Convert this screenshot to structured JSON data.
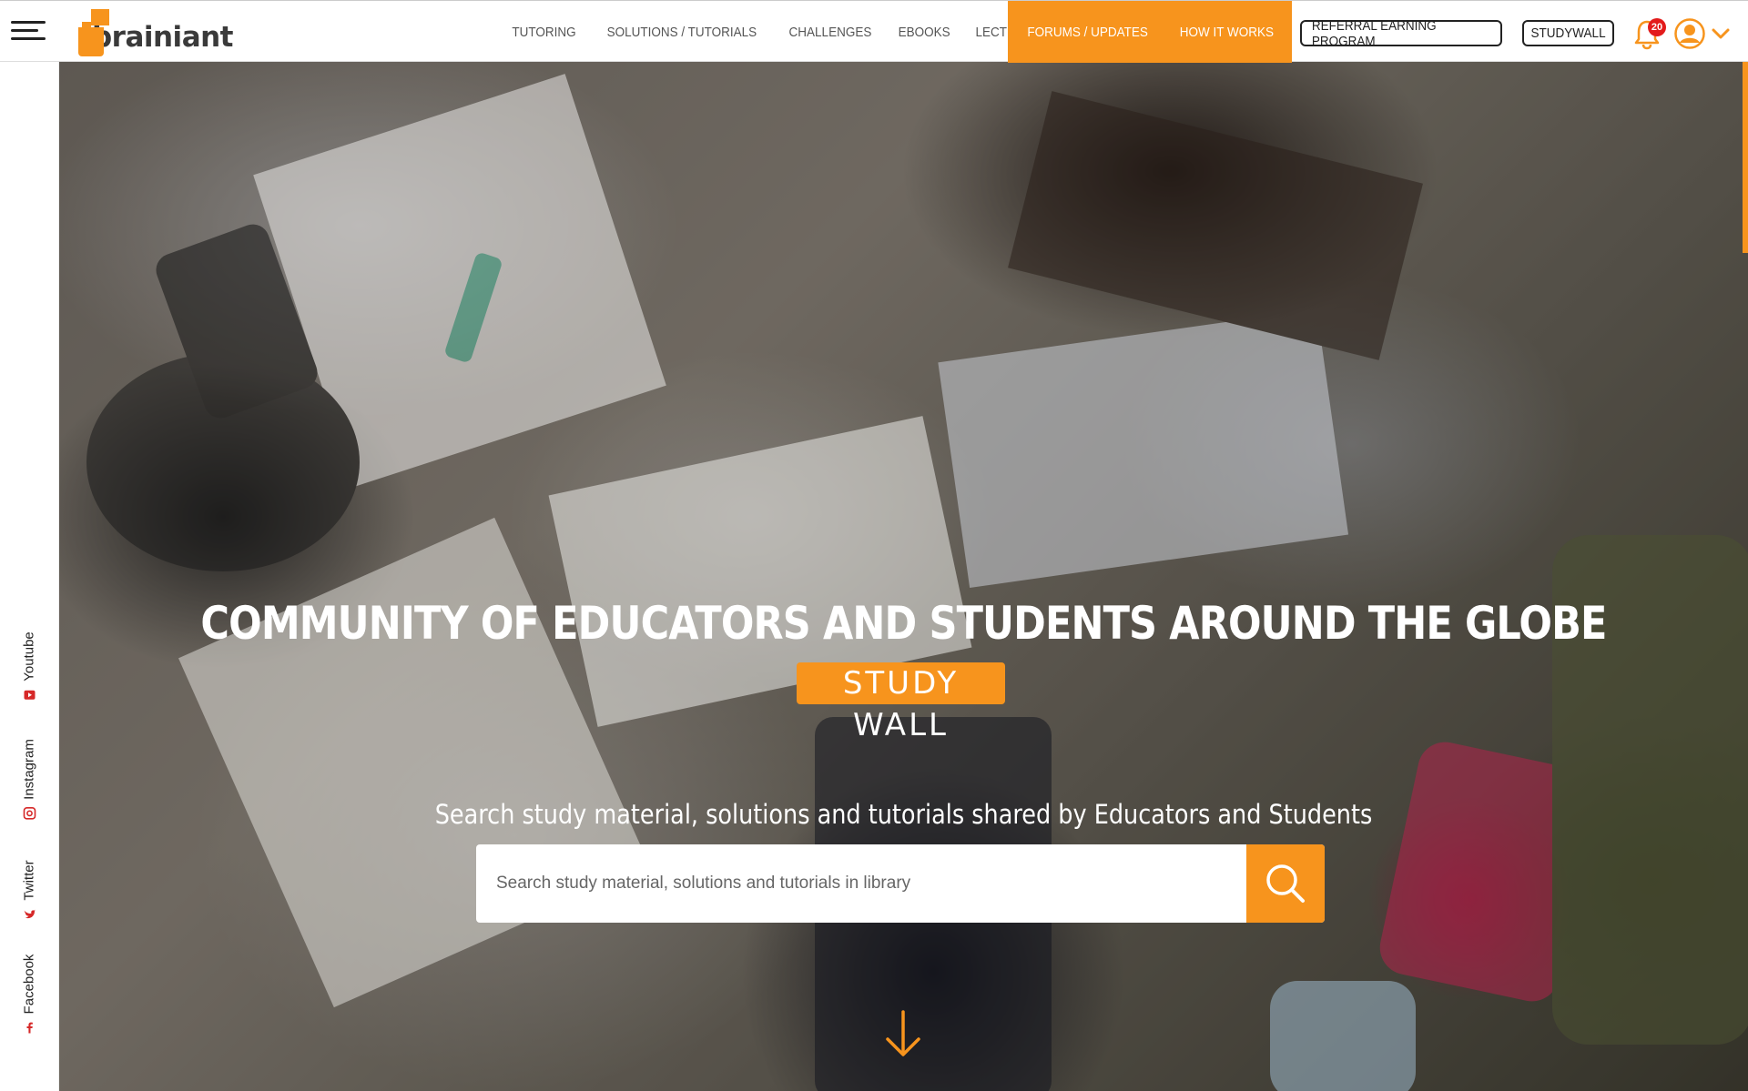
{
  "header": {
    "logo_text": "brainiant",
    "nav": [
      "TUTORING",
      "SOLUTIONS / TUTORIALS",
      "CHALLENGES",
      "EBOOKS",
      "LECTURES"
    ],
    "nav_highlight": [
      "FORUMS / UPDATES",
      "HOW IT WORKS"
    ],
    "referral_label": "REFERRAL EARNING PROGRAM",
    "studywall_label": "STUDYWALL",
    "notification_count": "20",
    "icons": {
      "menu": "hamburger-icon",
      "bell": "bell-icon",
      "user": "user-avatar-icon",
      "dropdown": "chevron-down-icon"
    }
  },
  "social": {
    "youtube": "Youtube",
    "instagram": "Instagram",
    "twitter": "Twitter",
    "facebook": "Facebook"
  },
  "hero": {
    "title": "COMMUNITY OF EDUCATORS AND STUDENTS AROUND THE GLOBE",
    "badge": "STUDY WALL",
    "subtitle": "Search study material, solutions and tutorials shared by Educators and Students",
    "search_placeholder": "Search study material, solutions and tutorials in library"
  },
  "colors": {
    "accent": "#f7941d",
    "badge_red": "#e31b1b",
    "text_dark": "#222222"
  }
}
